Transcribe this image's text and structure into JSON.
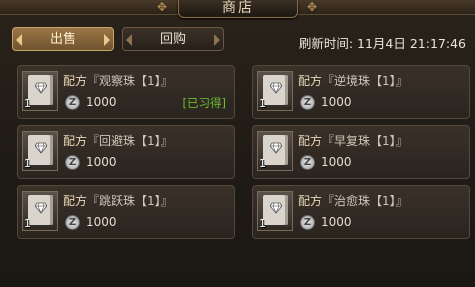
{
  "window": {
    "title": "商店"
  },
  "tabs": {
    "sell": "出售",
    "buyback": "回购"
  },
  "refresh": {
    "label": "刷新时间: 11月4日 21:17:46"
  },
  "currency_icon": "coin-z-icon",
  "items": [
    {
      "prefix": "配方",
      "name": "『观察珠【1】』",
      "qty": "1",
      "price": "1000",
      "status": "[已习得]"
    },
    {
      "prefix": "配方",
      "name": "『逆境珠【1】』",
      "qty": "1",
      "price": "1000",
      "status": ""
    },
    {
      "prefix": "配方",
      "name": "『回避珠【1】』",
      "qty": "1",
      "price": "1000",
      "status": ""
    },
    {
      "prefix": "配方",
      "name": "『早复珠【1】』",
      "qty": "1",
      "price": "1000",
      "status": ""
    },
    {
      "prefix": "配方",
      "name": "『跳跃珠【1】』",
      "qty": "1",
      "price": "1000",
      "status": ""
    },
    {
      "prefix": "配方",
      "name": "『治愈珠【1】』",
      "qty": "1",
      "price": "1000",
      "status": ""
    }
  ],
  "colors": {
    "learned": "#6bbf31",
    "tab_active": "#9b7745",
    "background": "#1f1a14"
  }
}
